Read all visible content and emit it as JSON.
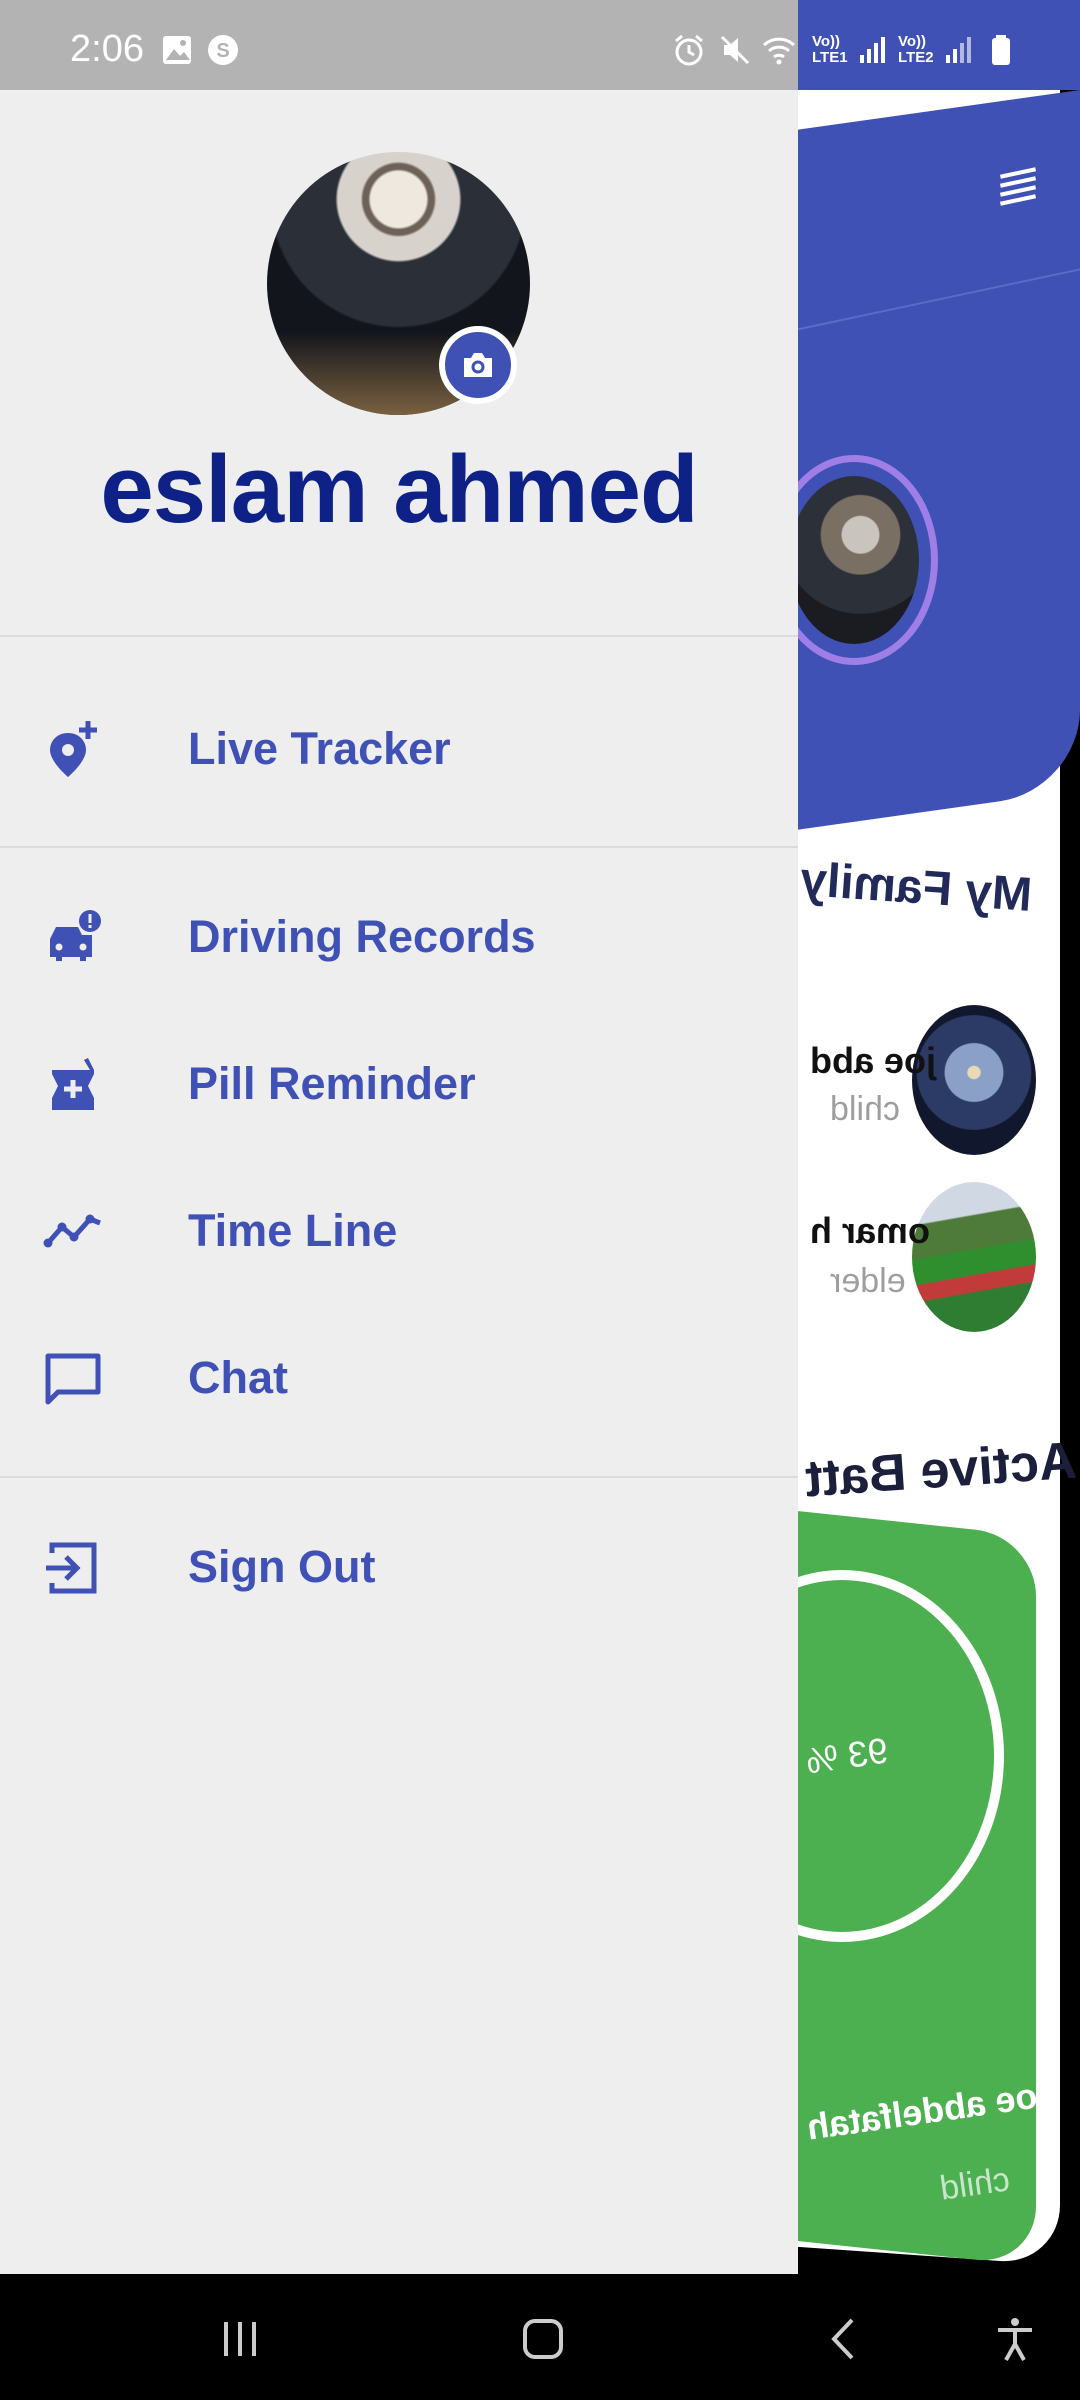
{
  "status_bar": {
    "time": "2:06",
    "sim1_line1": "Vo))",
    "sim1_line2": "LTE1",
    "sim2_line1": "Vo))",
    "sim2_line2": "LTE2",
    "icons": [
      "image-icon",
      "skype-icon",
      "alarm-icon",
      "mute-icon",
      "wifi-icon",
      "signal-icon",
      "signal-icon",
      "battery-icon"
    ]
  },
  "drawer": {
    "user_name": "eslam ahmed",
    "menu": [
      {
        "label": "Live Tracker",
        "icon": "location-add-icon"
      },
      {
        "label": "Driving Records",
        "icon": "car-alert-icon"
      },
      {
        "label": "Pill Reminder",
        "icon": "medicine-icon"
      },
      {
        "label": "Time Line",
        "icon": "timeline-icon"
      },
      {
        "label": "Chat",
        "icon": "chat-icon"
      },
      {
        "label": "Sign Out",
        "icon": "sign-out-icon"
      }
    ]
  },
  "background": {
    "family_title": "My Family",
    "members": [
      {
        "name": "joe abd",
        "role": "child"
      },
      {
        "name": "omar h",
        "role": "elder"
      }
    ],
    "battery_title": "Active Batt",
    "battery_percent": "93 %",
    "battery_name": "joe abdelfatah",
    "battery_role": "child"
  },
  "colors": {
    "accent": "#3f51b5",
    "name_color": "#0d2187",
    "drawer_bg": "#eeeeee",
    "battery_card": "#4caf50"
  }
}
